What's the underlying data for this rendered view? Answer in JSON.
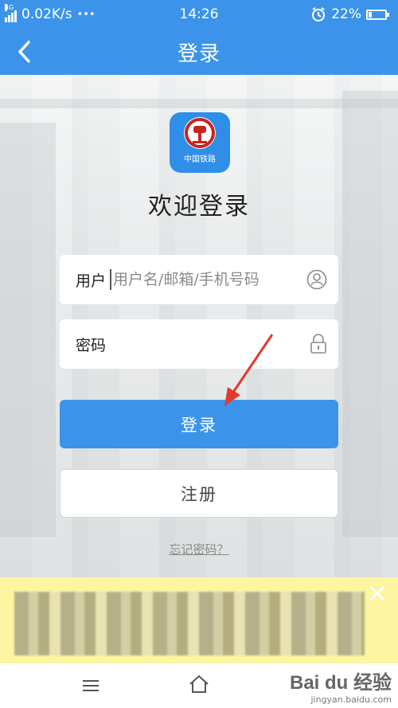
{
  "status_bar": {
    "network": "4G",
    "speed": "0.02K/s",
    "more": "•••",
    "time": "14:26",
    "battery_percent": "22%",
    "battery_level": 0.22
  },
  "nav": {
    "title": "登录"
  },
  "logo": {
    "text": "中国铁路",
    "color": "#2f8fe8",
    "emblem_color": "#c8241e"
  },
  "welcome": "欢迎登录",
  "form": {
    "user_label": "用户",
    "user_placeholder": "用户名/邮箱/手机号码",
    "user_value": "",
    "password_label": "密码",
    "password_value": ""
  },
  "buttons": {
    "login": "登录",
    "register": "注册",
    "forgot": "忘记密码？"
  },
  "watermark": {
    "brand": "Bai du 经验",
    "url": "jingyan.baidu.com"
  },
  "colors": {
    "accent": "#3b94ea",
    "banner": "#fdf5a0",
    "arrow": "#e23a2e"
  }
}
